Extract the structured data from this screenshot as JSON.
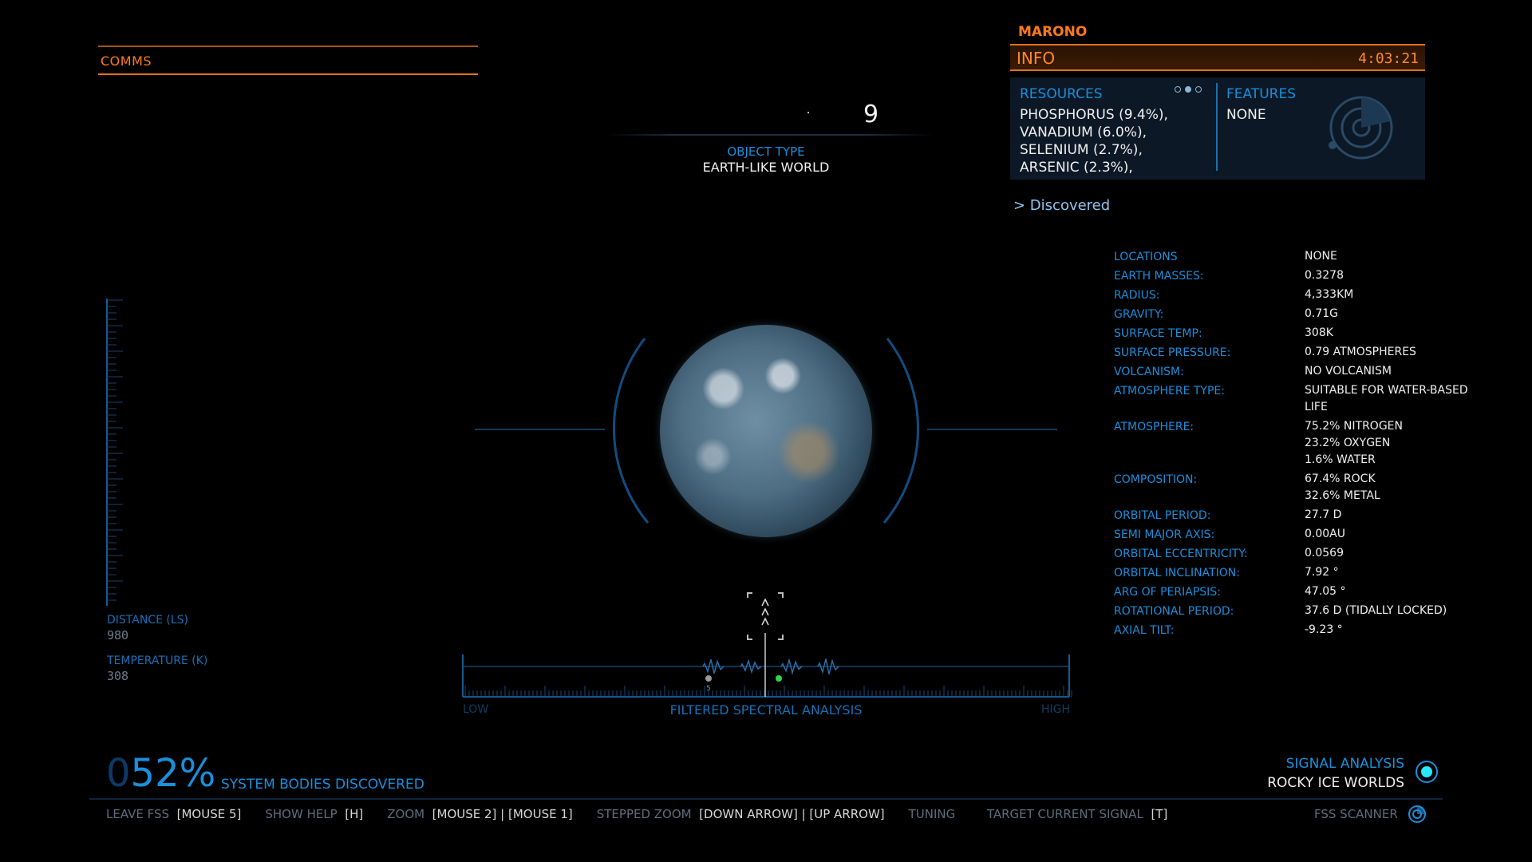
{
  "comms": {
    "title": "COMMS"
  },
  "target": {
    "number": "9",
    "object_type_label": "OBJECT TYPE",
    "object_type_value": "EARTH-LIKE WORLD"
  },
  "info_panel": {
    "system_name": "MARONO",
    "title": "INFO",
    "time": "4:03:21",
    "resources_label": "RESOURCES",
    "resources": [
      "PHOSPHORUS (9.4%),",
      "VANADIUM (6.0%),",
      "SELENIUM (2.7%),",
      "ARSENIC (2.3%),"
    ],
    "features_label": "FEATURES",
    "features_value": "NONE",
    "discovered": "> Discovered"
  },
  "properties": [
    {
      "label": "LOCATIONS",
      "value": [
        "NONE"
      ]
    },
    {
      "label": "EARTH MASSES:",
      "value": [
        "0.3278"
      ]
    },
    {
      "label": "RADIUS:",
      "value": [
        "4,333KM"
      ]
    },
    {
      "label": "GRAVITY:",
      "value": [
        "0.71G"
      ]
    },
    {
      "label": "SURFACE TEMP:",
      "value": [
        "308K"
      ]
    },
    {
      "label": "SURFACE PRESSURE:",
      "value": [
        "0.79 ATMOSPHERES"
      ]
    },
    {
      "label": "VOLCANISM:",
      "value": [
        "NO VOLCANISM"
      ]
    },
    {
      "label": "ATMOSPHERE TYPE:",
      "value": [
        "SUITABLE FOR WATER-BASED",
        "LIFE"
      ]
    },
    {
      "label": "ATMOSPHERE:",
      "value": [
        "75.2% NITROGEN",
        "23.2% OXYGEN",
        "1.6% WATER"
      ]
    },
    {
      "label": "COMPOSITION:",
      "value": [
        "67.4% ROCK",
        "32.6% METAL"
      ]
    },
    {
      "label": "ORBITAL PERIOD:",
      "value": [
        "27.7 D"
      ]
    },
    {
      "label": "SEMI MAJOR AXIS:",
      "value": [
        "0.00AU"
      ]
    },
    {
      "label": "ORBITAL ECCENTRICITY:",
      "value": [
        "0.0569"
      ]
    },
    {
      "label": "ORBITAL INCLINATION:",
      "value": [
        "7.92 °"
      ]
    },
    {
      "label": "ARG OF PERIAPSIS:",
      "value": [
        "47.05 °"
      ]
    },
    {
      "label": "ROTATIONAL PERIOD:",
      "value": [
        "37.6 D (TIDALLY LOCKED)"
      ]
    },
    {
      "label": "AXIAL TILT:",
      "value": [
        "-9.23 °"
      ]
    }
  ],
  "left_readouts": {
    "distance_label": "DISTANCE (LS)",
    "distance_value": "980",
    "temperature_label": "TEMPERATURE (K)",
    "temperature_value": "308"
  },
  "spectrum": {
    "low_label": "LOW",
    "high_label": "HIGH",
    "title": "FILTERED SPECTRAL ANALYSIS",
    "marker_label": "5"
  },
  "discovery": {
    "percent_leading": "0",
    "percent": "52%",
    "label": "SYSTEM BODIES DISCOVERED"
  },
  "signal": {
    "label": "SIGNAL ANALYSIS",
    "value": "ROCKY ICE WORLDS"
  },
  "hints": [
    {
      "key": "LEAVE FSS",
      "value": "[MOUSE 5]"
    },
    {
      "key": "SHOW HELP",
      "value": "[H]"
    },
    {
      "key": "ZOOM",
      "value": "[MOUSE 2] |  [MOUSE 1]"
    },
    {
      "key": "STEPPED ZOOM",
      "value": "[DOWN ARROW] |  [UP ARROW]"
    },
    {
      "key": "TUNING",
      "value": ""
    },
    {
      "key": "TARGET CURRENT SIGNAL",
      "value": "[T]"
    }
  ],
  "fss_label": "FSS SCANNER",
  "icons": {
    "radar": "radar-icon",
    "signal": "signal-icon",
    "fss": "fss-scanner-icon"
  },
  "colors": {
    "accent_blue": "#1a8fdc",
    "accent_orange": "#ff7a1a",
    "signal_cyan": "#29e8ff"
  }
}
